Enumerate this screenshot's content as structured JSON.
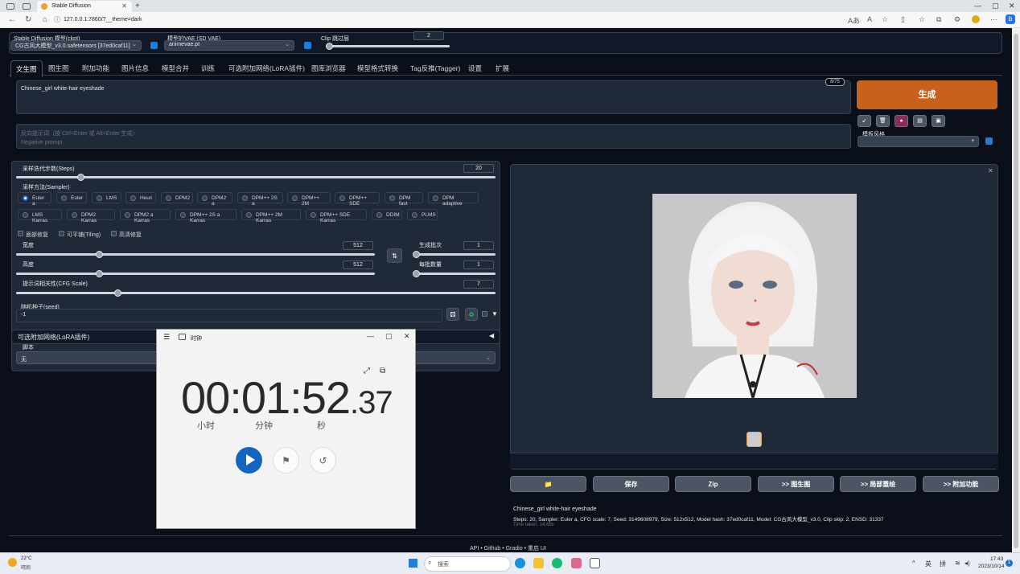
{
  "browser": {
    "tab_title": "Stable Diffusion",
    "url": "127.0.0.1:7860/?__theme=dark"
  },
  "models": {
    "ckpt_label": "Stable Diffusion 模型(ckpt)",
    "ckpt_value": "CG古风大模型_v3.0.safetensors [37ed0caf11]",
    "vae_label": "模型的VAE (SD VAE)",
    "vae_value": "animevae.pt",
    "clip_label": "Clip 跳过层",
    "clip_value": "2"
  },
  "tabs": [
    "文生图",
    "图生图",
    "附加功能",
    "图片信息",
    "模型合并",
    "训练",
    "可选附加网络(LoRA插件)",
    "图库浏览器",
    "模型格式转换",
    "Tag反推(Tagger)",
    "设置",
    "扩展"
  ],
  "prompt": {
    "value": "Chinese_girl  white-hair  eyeshade",
    "counter": "8/75",
    "negative_placeholder": "反向提示词（按 Ctrl+Enter 或 Alt+Enter 生成）",
    "negative_placeholder2": "Negative prompt"
  },
  "generate_label": "生成",
  "style_label": "模板风格",
  "steps": {
    "label": "采样迭代步数(Steps)",
    "value": "20",
    "fraction": 0.2
  },
  "sampler": {
    "label": "采样方法(Sampler)",
    "options_row1": [
      "Euler a",
      "Euler",
      "LMS",
      "Heun",
      "DPM2",
      "DPM2 a",
      "DPM++ 2S a",
      "DPM++ 2M",
      "DPM++ SDE",
      "DPM fast",
      "DPM adaptive"
    ],
    "options_row2": [
      "LMS Karras",
      "DPM2 Karras",
      "DPM2 a Karras",
      "DPM++ 2S a Karras",
      "DPM++ 2M Karras",
      "DPM++ SDE Karras",
      "DDIM",
      "PLMS"
    ],
    "selected": "Euler a"
  },
  "checks": [
    "面部修复",
    "可平铺(Tiling)",
    "高清修复"
  ],
  "width": {
    "label": "宽度",
    "value": "512"
  },
  "height": {
    "label": "高度",
    "value": "512"
  },
  "batch_count": {
    "label": "生成批次",
    "value": "1"
  },
  "batch_size": {
    "label": "每批数量",
    "value": "1"
  },
  "cfg": {
    "label": "提示词相关性(CFG Scale)",
    "value": "7"
  },
  "seed": {
    "label": "随机种子(seed)",
    "value": "-1"
  },
  "lora_section": "可选附加网络(LoRA插件)",
  "script": {
    "label": "脚本",
    "value": "无"
  },
  "output": {
    "buttons": [
      "保存",
      "Zip",
      ">> 图生图",
      ">> 局部重绘",
      ">> 附加功能"
    ],
    "info_prompt": "Chinese_girl white-hair eyeshade",
    "info_params": "Steps: 20, Sampler: Euler a, CFG scale: 7, Seed: 3149608979, Size: 512x512, Model hash: 37ed0caf11, Model: CG古风大模型_v3.0, Clip skip: 2, ENSD: 31337",
    "time_taken": "Time taken: 14.68s"
  },
  "footer": [
    "API",
    "Github",
    "Gradio",
    "重启 UI"
  ],
  "clock": {
    "title": "时钟",
    "hours": "00",
    "minutes": "01",
    "seconds": "52",
    "fraction": ".37",
    "unit_h": "小时",
    "unit_m": "分钟",
    "unit_s": "秒"
  },
  "taskbar": {
    "weather_temp": "22°C",
    "weather_desc": "晴朗",
    "search": "搜索",
    "ime1": "英",
    "ime2": "拼",
    "time": "17:43",
    "date": "2023/10/14",
    "notif": "1"
  },
  "colors": {
    "accent": "#c8611b",
    "app_bg": "#0b0f19",
    "panel": "#1f2937",
    "play": "#1565c0"
  }
}
